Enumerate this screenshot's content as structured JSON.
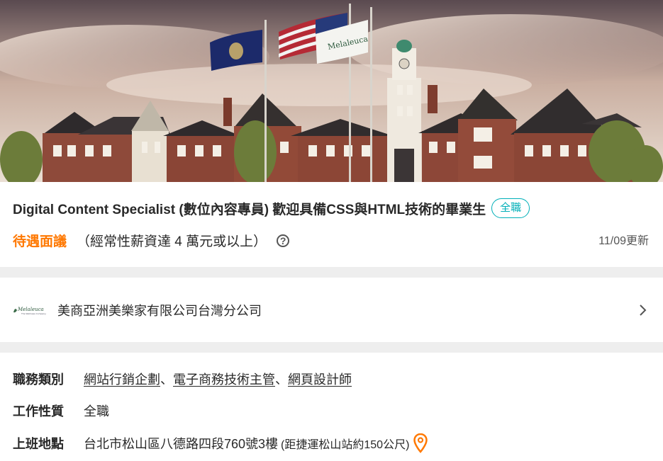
{
  "hero": {
    "flag_text": "Melaleuca"
  },
  "job": {
    "title": "Digital Content Specialist (數位內容專員) 歡迎具備CSS與HTML技術的畢業生",
    "badge": "全職",
    "salary": "待遇面議",
    "salary_note": "（經常性薪資達 4 萬元或以上）",
    "help_icon_label": "?",
    "updated": "11/09更新"
  },
  "company": {
    "logo_text": "Melaleuca",
    "logo_subtext": "The Wellness Company",
    "name": "美商亞洲美樂家有限公司台灣分公司"
  },
  "details": {
    "category_label": "職務類別",
    "categories": [
      "網站行銷企劃",
      "電子商務技術主管",
      "網頁設計師"
    ],
    "separator": "、",
    "type_label": "工作性質",
    "type_value": "全職",
    "location_label": "上班地點",
    "location_value": "台北市松山區八德路四段760號3樓",
    "mrt_note": "(距捷運松山站約150公尺)"
  },
  "colors": {
    "accent_orange": "#ff7800",
    "badge_teal": "#00afb8",
    "divider_gray": "#eeeeee"
  }
}
